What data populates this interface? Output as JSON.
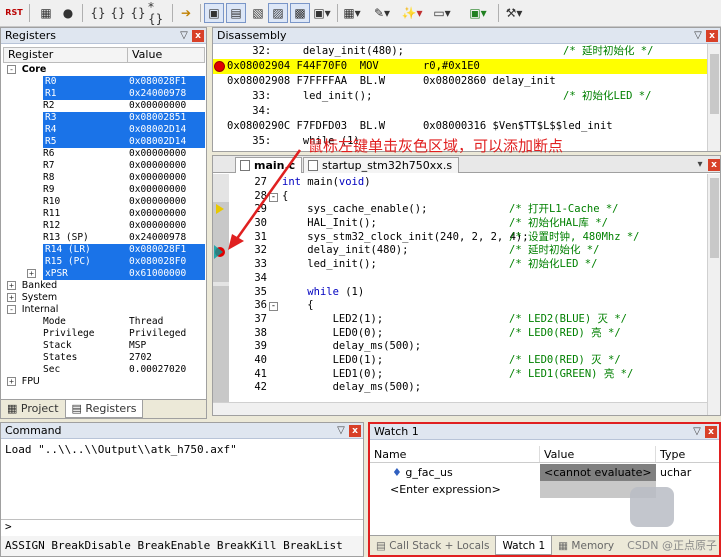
{
  "toolbar": {
    "rst_label": "RST",
    "items": [
      "rst-icon",
      "stop-icon",
      "step-into-icon",
      "step-over-icon",
      "step-out-icon",
      "run-to-cursor-icon",
      "show-next-icon",
      "command-window-icon",
      "disassembly-window-icon",
      "symbols-window-icon",
      "registers-window-icon",
      "call-stack-icon",
      "watch-window-icon",
      "memory-window-icon",
      "serial-window-icon",
      "analysis-window-icon",
      "trace-window-icon",
      "system-viewer-icon",
      "toolbox-icon"
    ]
  },
  "registers": {
    "title": "Registers",
    "col_register": "Register",
    "col_value": "Value",
    "core_label": "Core",
    "core_rows": [
      {
        "name": "R0",
        "value": "0x080028F1",
        "selected": true
      },
      {
        "name": "R1",
        "value": "0x24000978",
        "selected": true
      },
      {
        "name": "R2",
        "value": "0x00000000",
        "selected": false
      },
      {
        "name": "R3",
        "value": "0x08002851",
        "selected": true
      },
      {
        "name": "R4",
        "value": "0x08002D14",
        "selected": true
      },
      {
        "name": "R5",
        "value": "0x08002D14",
        "selected": true
      },
      {
        "name": "R6",
        "value": "0x00000000",
        "selected": false
      },
      {
        "name": "R7",
        "value": "0x00000000",
        "selected": false
      },
      {
        "name": "R8",
        "value": "0x00000000",
        "selected": false
      },
      {
        "name": "R9",
        "value": "0x00000000",
        "selected": false
      },
      {
        "name": "R10",
        "value": "0x00000000",
        "selected": false
      },
      {
        "name": "R11",
        "value": "0x00000000",
        "selected": false
      },
      {
        "name": "R12",
        "value": "0x00000000",
        "selected": false
      },
      {
        "name": "R13 (SP)",
        "value": "0x24000978",
        "selected": false
      },
      {
        "name": "R14 (LR)",
        "value": "0x080028F1",
        "selected": true
      },
      {
        "name": "R15 (PC)",
        "value": "0x080028F0",
        "selected": true
      },
      {
        "name": "xPSR",
        "value": "0x61000000",
        "selected": true
      }
    ],
    "banked_label": "Banked",
    "system_label": "System",
    "internal_label": "Internal",
    "internal_rows": [
      {
        "name": "Mode",
        "value": "Thread"
      },
      {
        "name": "Privilege",
        "value": "Privileged"
      },
      {
        "name": "Stack",
        "value": "MSP"
      },
      {
        "name": "States",
        "value": "2702"
      },
      {
        "name": "Sec",
        "value": "0.00027020"
      }
    ],
    "fpu_label": "FPU",
    "tab_project": "Project",
    "tab_registers": "Registers"
  },
  "disassembly": {
    "title": "Disassembly",
    "rows": [
      {
        "text": "    32:     delay_init(480);",
        "comment": "/* 延时初始化 */",
        "highlight": false,
        "bp": false
      },
      {
        "text": "0x08002904 F44F70F0  MOV       r0,#0x1E0",
        "comment": "",
        "highlight": true,
        "bp": true
      },
      {
        "text": "0x08002908 F7FFFFAA  BL.W      0x08002860 delay_init",
        "comment": "",
        "highlight": false,
        "bp": false
      },
      {
        "text": "    33:     led_init();",
        "comment": "/* 初始化LED */",
        "highlight": false,
        "bp": false
      },
      {
        "text": "    34:",
        "comment": "",
        "highlight": false,
        "bp": false
      },
      {
        "text": "0x0800290C F7FDFD03  BL.W      0x08000316 $Ven$TT$L$$led_init",
        "comment": "",
        "highlight": false,
        "bp": false
      },
      {
        "text": "    35:     while (1)",
        "comment": "",
        "highlight": false,
        "bp": false
      }
    ]
  },
  "editor": {
    "tab_main": "main.c",
    "tab_startup": "startup_stm32h750xx.s",
    "rows": [
      {
        "ln": "27",
        "fold": "",
        "src": "int main(void)",
        "comment": ""
      },
      {
        "ln": "28",
        "fold": "-",
        "src": "{",
        "comment": ""
      },
      {
        "ln": "29",
        "fold": "",
        "src": "    sys_cache_enable();",
        "comment": "/* 打开L1-Cache */"
      },
      {
        "ln": "30",
        "fold": "",
        "src": "    HAL_Init();",
        "comment": "/* 初始化HAL库 */"
      },
      {
        "ln": "31",
        "fold": "",
        "src": "    sys_stm32_clock_init(240, 2, 2, 4);",
        "comment": "/* 设置时钟, 480Mhz */"
      },
      {
        "ln": "32",
        "fold": "",
        "src": "    delay_init(480);",
        "comment": "/* 延时初始化 */"
      },
      {
        "ln": "33",
        "fold": "",
        "src": "    led_init();",
        "comment": "/* 初始化LED */"
      },
      {
        "ln": "34",
        "fold": "",
        "src": "",
        "comment": ""
      },
      {
        "ln": "35",
        "fold": "",
        "src": "    while (1)",
        "comment": ""
      },
      {
        "ln": "36",
        "fold": "-",
        "src": "    {",
        "comment": ""
      },
      {
        "ln": "37",
        "fold": "",
        "src": "        LED2(1);",
        "comment": "/* LED2(BLUE) 灭 */"
      },
      {
        "ln": "38",
        "fold": "",
        "src": "        LED0(0);",
        "comment": "/* LED0(RED) 亮 */"
      },
      {
        "ln": "39",
        "fold": "",
        "src": "        delay_ms(500);",
        "comment": ""
      },
      {
        "ln": "40",
        "fold": "",
        "src": "        LED0(1);",
        "comment": "/* LED0(RED) 灭 */"
      },
      {
        "ln": "41",
        "fold": "",
        "src": "        LED1(0);",
        "comment": "/* LED1(GREEN) 亮 */"
      },
      {
        "ln": "42",
        "fold": "",
        "src": "        delay_ms(500);",
        "comment": ""
      }
    ]
  },
  "annotation": "鼠标左键单击灰色区域，可以添加断点",
  "command": {
    "title": "Command",
    "output": "Load \"..\\\\..\\\\Output\\\\atk_h750.axf\"",
    "prompt": ">",
    "help": "ASSIGN BreakDisable BreakEnable BreakKill BreakList"
  },
  "watch": {
    "title": "Watch 1",
    "col_name": "Name",
    "col_value": "Value",
    "col_type": "Type",
    "rows": [
      {
        "name": "g_fac_us",
        "value": "<cannot evaluate>",
        "type": "uchar"
      },
      {
        "name": "<Enter expression>",
        "value": "",
        "type": ""
      }
    ],
    "tab_callstack": "Call Stack + Locals",
    "tab_watch": "Watch 1",
    "tab_memory": "Memory"
  },
  "watermark": "CSDN @正点原子",
  "colors": {
    "selection": "#1a73e8",
    "highlight": "#ffff00",
    "annotation": "#e02020",
    "comment": "#008000",
    "keyword": "#0000c0"
  }
}
